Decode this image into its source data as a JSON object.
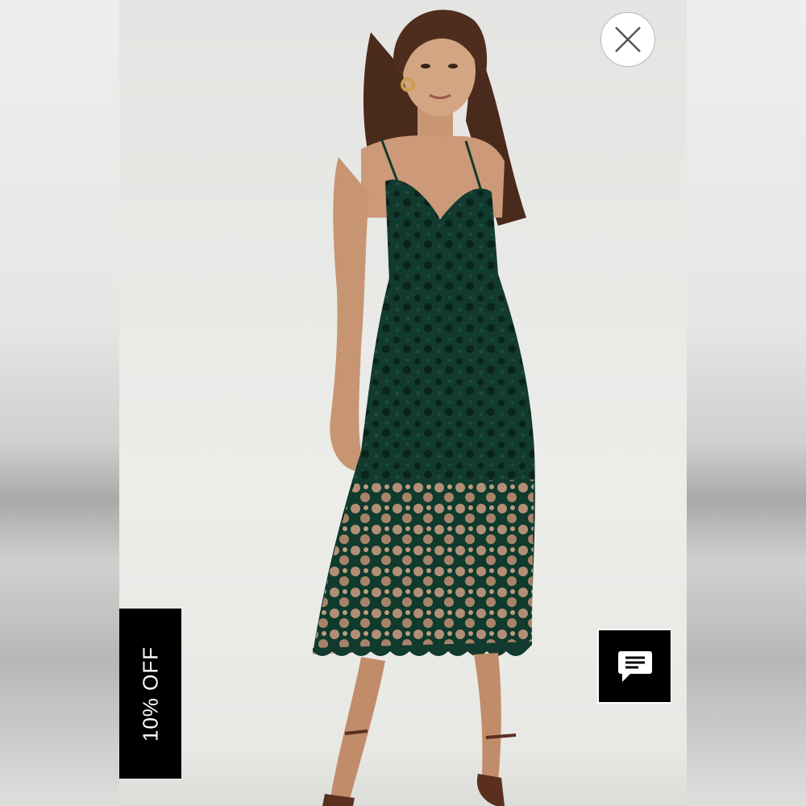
{
  "promo": {
    "label": "10% OFF"
  },
  "icons": {
    "close": "close-icon",
    "chat": "chat-icon"
  },
  "colors": {
    "dress": "#123a2e",
    "promo_background": "#000000",
    "chat_background": "#000000"
  }
}
